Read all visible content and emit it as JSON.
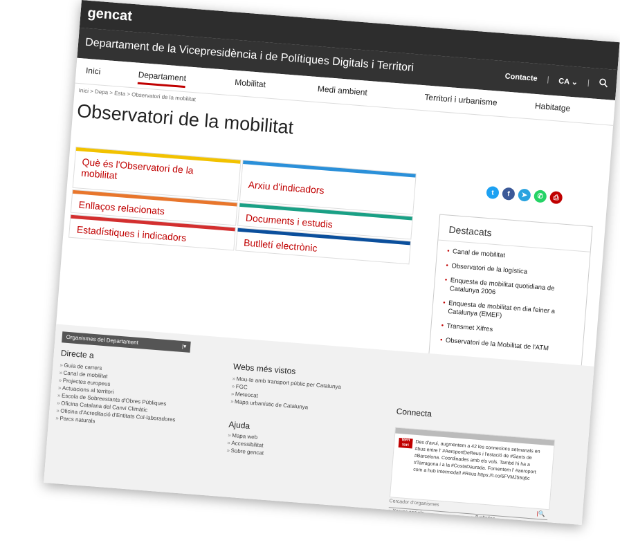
{
  "header": {
    "logo": "gencat",
    "department_title": "Departament de la Vicepresidència i de Polítiques Digitals i Territori",
    "contacte": "Contacte",
    "language": "CA",
    "language_caret": "⌄"
  },
  "menu": {
    "items": [
      "Inici",
      "Departament",
      "Mobilitat",
      "Medi ambient",
      "Territori i urbanisme",
      "Habitatge"
    ],
    "active": "Departament"
  },
  "breadcrumb": "Inici > Depa > Esta > Observatori de la mobilitat",
  "page_title": "Observatori de la mobilitat",
  "tiles": [
    {
      "label": "Què és l'Observatori de la mobilitat",
      "color": "#f2c200"
    },
    {
      "label": "Arxiu d'indicadors",
      "color": "#2b90d9"
    },
    {
      "label": "Enllaços relacionats",
      "color": "#e8762c"
    },
    {
      "label": "Documents i estudis",
      "color": "#1aa085"
    },
    {
      "label": "Estadístiques i indicadors",
      "color": "#d32f2f"
    },
    {
      "label": "Butlletí electrònic",
      "color": "#0b4f9c"
    }
  ],
  "social": [
    {
      "icon": "twitter-icon",
      "glyph": "t",
      "color": "#1da1f2"
    },
    {
      "icon": "facebook-icon",
      "glyph": "f",
      "color": "#3b5998"
    },
    {
      "icon": "telegram-icon",
      "glyph": "➤",
      "color": "#2aa3df"
    },
    {
      "icon": "whatsapp-icon",
      "glyph": "✆",
      "color": "#25d366"
    },
    {
      "icon": "print-icon",
      "glyph": "⎙",
      "color": "#c00000"
    }
  ],
  "destacats": {
    "title": "Destacats",
    "items": [
      "Canal de mobilitat",
      "Observatori de la logística",
      "Enquesta de mobilitat quotidiana de Catalunya 2006",
      "Enquesta de mobilitat en dia feiner a Catalunya (EMEF)",
      "Transmet Xifres",
      "Observatori de la Mobilitat de l'ATM"
    ]
  },
  "footer": {
    "org_select": "Organismes del Departament",
    "org_caret": "|▾",
    "directe_title": "Directe a",
    "directe_items": [
      "Guia de carrers",
      "Canal de mobilitat",
      "Projectes europeus",
      "Actuacions al territori",
      "Escola de Sobreestants d'Obres Públiques",
      "Oficina Catalana del Canvi Climàtic",
      "Oficina d'Acreditació d'Entitats Col·laboradores",
      "Parcs naturals"
    ],
    "webs_title": "Webs més vistos",
    "webs_items": [
      "Mou-te amb transport públic per Catalunya",
      "FGC",
      "Meteocat",
      "Mapa urbanístic de Catalunya"
    ],
    "ajuda_title": "Ajuda",
    "ajuda_items": [
      "Mapa web",
      "Accessibilitat",
      "Sobre gencat"
    ],
    "connecta_title": "Connecta",
    "tweet_logo": "terri tori",
    "tweet_text": "Des d'avui, augmentem a 42 les connexions setmanals en #bus entre l' #AeroportDeReus i l'estació de #Sants de #Barcelona. Coordinades amb els vols. També hi ha a #Tarragona i a la #CostaDaurada. Fomentem l' #aeroport com a hub intermodal! #Reus https://t.co/6FVMJ55q6c",
    "search_placeholder": "Cercador d'organismes",
    "xarxes": "» Xarxes socials",
    "butlletins": "» Butlletins"
  }
}
